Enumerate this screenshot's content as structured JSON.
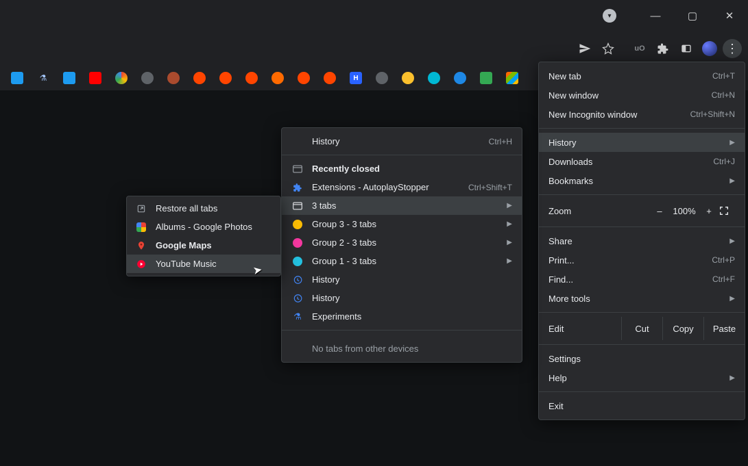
{
  "window_controls": {
    "minimize": "—",
    "maximize": "▢",
    "close": "✕"
  },
  "toolbar": {
    "send_icon": "send-icon",
    "star_icon": "star-icon",
    "shield_icon": "ublock-icon",
    "puzzle_icon": "extensions-icon",
    "tab_icon": "tab-icon",
    "avatar_icon": "avatar-icon",
    "kebab": "⋮"
  },
  "main_menu": {
    "new_tab": {
      "label": "New tab",
      "shortcut": "Ctrl+T"
    },
    "new_window": {
      "label": "New window",
      "shortcut": "Ctrl+N"
    },
    "incognito": {
      "label": "New Incognito window",
      "shortcut": "Ctrl+Shift+N"
    },
    "history": {
      "label": "History"
    },
    "downloads": {
      "label": "Downloads",
      "shortcut": "Ctrl+J"
    },
    "bookmarks": {
      "label": "Bookmarks"
    },
    "zoom": {
      "label": "Zoom",
      "minus": "–",
      "value": "100%",
      "plus": "+"
    },
    "share": {
      "label": "Share"
    },
    "print": {
      "label": "Print...",
      "shortcut": "Ctrl+P"
    },
    "find": {
      "label": "Find...",
      "shortcut": "Ctrl+F"
    },
    "more_tools": {
      "label": "More tools"
    },
    "edit": {
      "label": "Edit",
      "cut": "Cut",
      "copy": "Copy",
      "paste": "Paste"
    },
    "settings": {
      "label": "Settings"
    },
    "help": {
      "label": "Help"
    },
    "exit": {
      "label": "Exit"
    }
  },
  "history_menu": {
    "title": {
      "label": "History",
      "shortcut": "Ctrl+H"
    },
    "recently": {
      "label": "Recently closed"
    },
    "ext_item": {
      "label": "Extensions - AutoplayStopper",
      "shortcut": "Ctrl+Shift+T"
    },
    "tabs3": {
      "label": "3 tabs"
    },
    "group3": {
      "label": "Group 3 - 3 tabs"
    },
    "group2": {
      "label": "Group 2 - 3 tabs"
    },
    "group1": {
      "label": "Group 1 - 3 tabs"
    },
    "hist1": {
      "label": "History"
    },
    "hist2": {
      "label": "History"
    },
    "experiments": {
      "label": "Experiments"
    },
    "footer": "No tabs from other devices"
  },
  "tabs_submenu": {
    "restore": {
      "label": "Restore all tabs"
    },
    "albums": {
      "label": "Albums - Google Photos"
    },
    "maps": {
      "label": "Google Maps"
    },
    "ytm": {
      "label": "YouTube Music"
    }
  }
}
